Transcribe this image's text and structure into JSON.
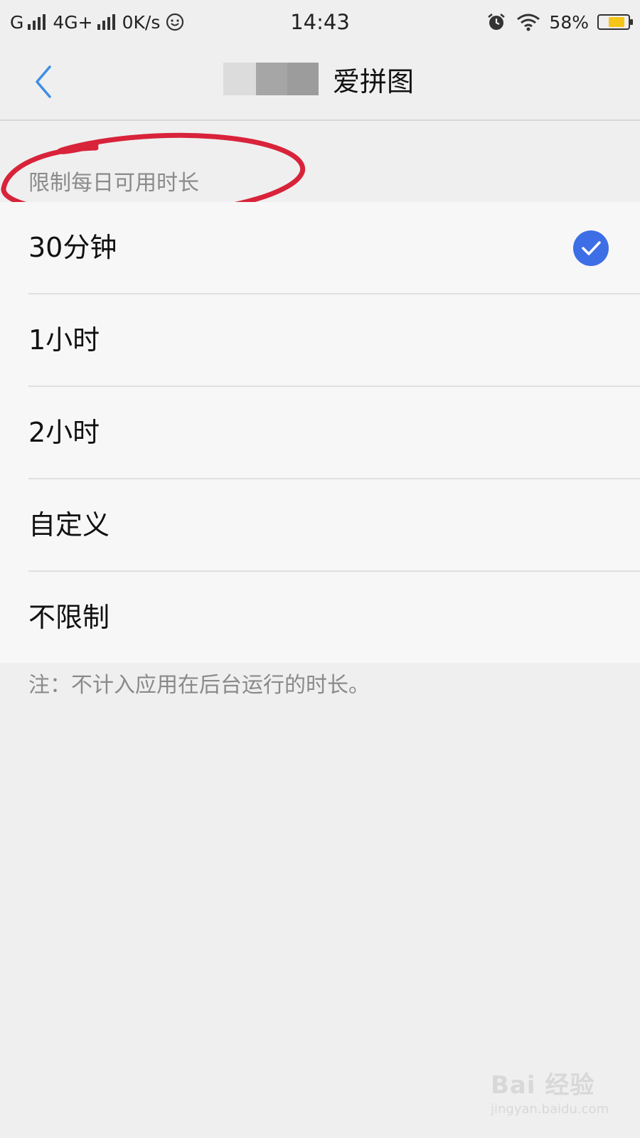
{
  "status_bar": {
    "carrier1": "G",
    "carrier2": "4G+",
    "net_speed": "0K/s",
    "time": "14:43",
    "battery_percent": "58%",
    "battery_level": 0.58,
    "battery_color": "#f5c518"
  },
  "nav": {
    "back_icon": "chevron-left-icon",
    "title": "爱拼图",
    "accent": "#3d8ee6"
  },
  "section": {
    "header": "限制每日可用时长"
  },
  "options": [
    {
      "label": "30分钟",
      "selected": true
    },
    {
      "label": "1小时",
      "selected": false
    },
    {
      "label": "2小时",
      "selected": false
    },
    {
      "label": "自定义",
      "selected": false
    },
    {
      "label": "不限制",
      "selected": false
    }
  ],
  "check_color": "#3d6ee6",
  "note": "注：不计入应用在后台运行的时长。",
  "watermark": {
    "main": "Bai  经验",
    "sub": "jingyan.baidu.com"
  }
}
